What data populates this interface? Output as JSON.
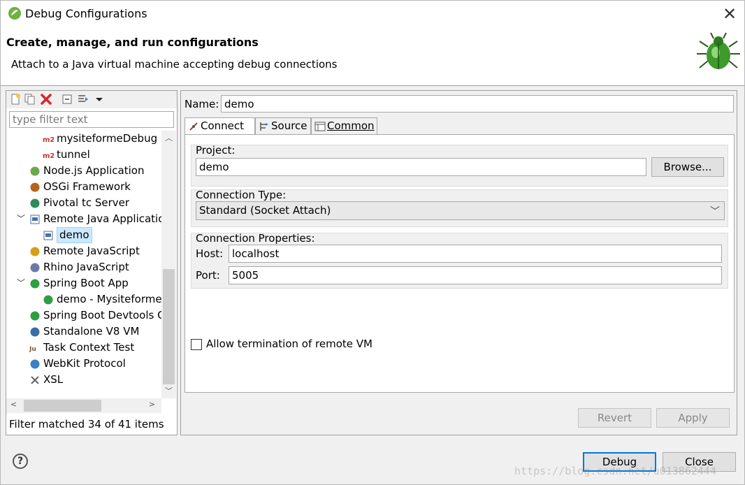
{
  "window": {
    "title": "Debug Configurations",
    "close_glyph": "✕",
    "title_icon": "eclipse-spring-icon"
  },
  "header": {
    "title": "Create, manage, and run configurations",
    "description": "Attach to a Java virtual machine accepting debug connections",
    "icon": "bug-icon"
  },
  "left_panel": {
    "filter_placeholder": "type filter text",
    "status": "Filter matched 34 of 41 items",
    "tree": [
      {
        "label": "mysiteformeDebug",
        "icon": "maven-m2-icon",
        "indent": 2
      },
      {
        "label": "tunnel",
        "icon": "maven-m2-icon",
        "indent": 2
      },
      {
        "label": "Node.js Application",
        "icon": "nodejs-icon",
        "indent": 1
      },
      {
        "label": "OSGi Framework",
        "icon": "osgi-icon",
        "indent": 1
      },
      {
        "label": "Pivotal tc Server",
        "icon": "pivotal-icon",
        "indent": 1
      },
      {
        "label": "Remote Java Applicatio",
        "icon": "remote-java-icon",
        "indent": 1,
        "expanded": true
      },
      {
        "label": "demo",
        "icon": "remote-java-icon",
        "indent": 2,
        "selected": true
      },
      {
        "label": "Remote JavaScript",
        "icon": "remote-js-icon",
        "indent": 1
      },
      {
        "label": "Rhino JavaScript",
        "icon": "rhino-icon",
        "indent": 1
      },
      {
        "label": "Spring Boot App",
        "icon": "spring-boot-icon",
        "indent": 1,
        "expanded": true
      },
      {
        "label": "demo - MysiteformeA",
        "icon": "spring-boot-icon",
        "indent": 2
      },
      {
        "label": "Spring Boot Devtools Cl",
        "icon": "spring-devtools-icon",
        "indent": 1
      },
      {
        "label": "Standalone V8 VM",
        "icon": "v8-icon",
        "indent": 1
      },
      {
        "label": "Task Context Test",
        "icon": "junit-icon",
        "indent": 1
      },
      {
        "label": "WebKit Protocol",
        "icon": "webkit-icon",
        "indent": 1
      },
      {
        "label": "XSL",
        "icon": "xsl-icon",
        "indent": 1
      }
    ]
  },
  "config": {
    "name_label": "Name:",
    "name_value": "demo",
    "tabs": [
      {
        "label": "Connect",
        "icon": "connect-icon",
        "active": true
      },
      {
        "label": "Source",
        "icon": "source-icon",
        "active": false
      },
      {
        "label": "Common",
        "icon": "common-icon",
        "active": false
      }
    ],
    "project_label": "Project:",
    "project_value": "demo",
    "browse_label": "Browse...",
    "connection_type_label": "Connection Type:",
    "connection_type_value": "Standard (Socket Attach)",
    "connection_props_label": "Connection Properties:",
    "host_label": "Host:",
    "host_value": "localhost",
    "port_label": "Port:",
    "port_value": "5005",
    "allow_termination_label": "Allow termination of remote VM",
    "revert_label": "Revert",
    "apply_label": "Apply"
  },
  "footer": {
    "debug_label": "Debug",
    "close_label": "Close",
    "watermark": "https://blog.csdn.net/u013862444"
  }
}
